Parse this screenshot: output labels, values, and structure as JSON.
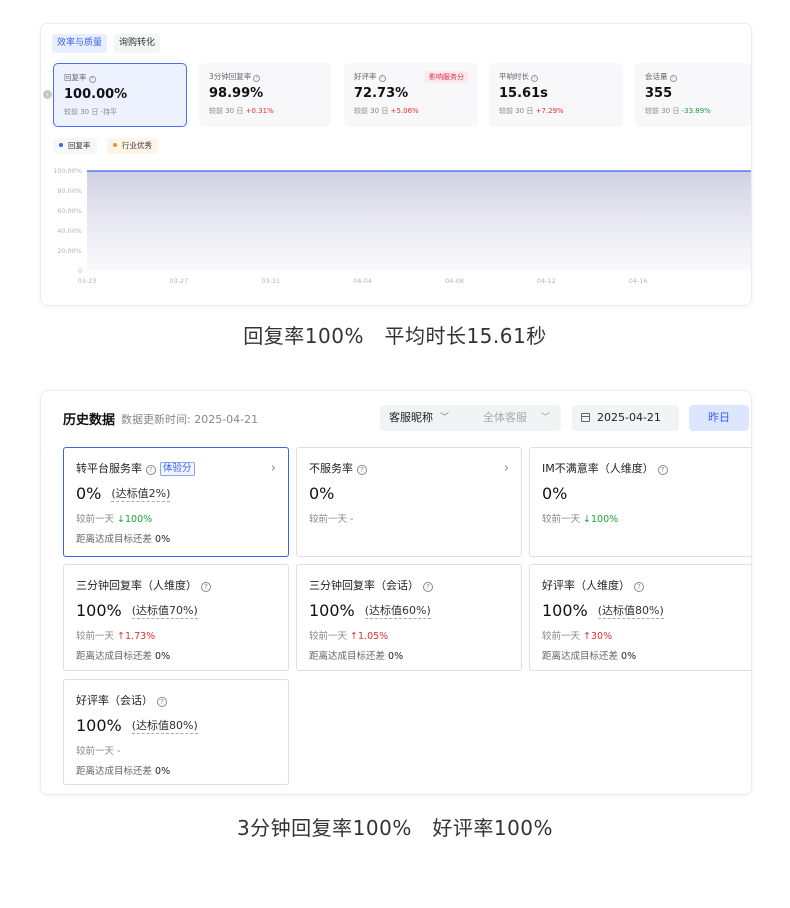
{
  "panel1": {
    "tabs": [
      {
        "label": "效率与质量",
        "active": true
      },
      {
        "label": "询购转化",
        "active": false
      }
    ],
    "metrics": [
      {
        "label": "回复率",
        "value": "100.00%",
        "cmp_prefix": "较前 30 日",
        "cmp_value": "-持平",
        "trend": "flat",
        "selected": true
      },
      {
        "label": "3分钟回复率",
        "value": "98.99%",
        "cmp_prefix": "较前 30 日",
        "cmp_value": "+0.31%",
        "trend": "up"
      },
      {
        "label": "好评率",
        "value": "72.73%",
        "cmp_prefix": "较前 30 日",
        "cmp_value": "+5.06%",
        "trend": "up",
        "badge": "影响服务分"
      },
      {
        "label": "平响时长",
        "value": "15.61s",
        "cmp_prefix": "较前 30 日",
        "cmp_value": "+7.29%",
        "trend": "up"
      },
      {
        "label": "会话量",
        "value": "355",
        "cmp_prefix": "较前 30 日",
        "cmp_value": "-33.89%",
        "trend": "down"
      }
    ],
    "legend": [
      {
        "label": "回复率",
        "color": "#3a63f0"
      },
      {
        "label": "行业优秀",
        "color": "#f5902a"
      }
    ]
  },
  "chart_data": {
    "type": "area",
    "x": [
      "03-23",
      "03-24",
      "03-25",
      "03-26",
      "03-27",
      "03-28",
      "03-29",
      "03-30",
      "03-31",
      "04-01",
      "04-02",
      "04-03",
      "04-04",
      "04-05",
      "04-06",
      "04-07",
      "04-08",
      "04-09",
      "04-10",
      "04-11",
      "04-12",
      "04-13",
      "04-14",
      "04-15",
      "04-16",
      "04-17",
      "04-18",
      "04-19",
      "04-20",
      "04-21"
    ],
    "xticks": [
      "03-23",
      "03-27",
      "03-31",
      "04-04",
      "04-08",
      "04-12",
      "04-16"
    ],
    "yticks": [
      "100.00%",
      "80.00%",
      "60.00%",
      "40.00%",
      "20.00%",
      "0"
    ],
    "ylim": [
      0,
      100
    ],
    "series": [
      {
        "name": "回复率",
        "values": [
          100,
          100,
          100,
          100,
          100,
          100,
          100,
          100,
          100,
          100,
          100,
          100,
          100,
          100,
          100,
          100,
          100,
          100,
          100,
          100,
          100,
          100,
          100,
          100,
          100,
          100,
          100,
          100,
          100,
          100
        ]
      }
    ],
    "grid": false,
    "legend": "top-left"
  },
  "caption1": "回复率100%　平均时长15.61秒",
  "panel2": {
    "title": "历史数据",
    "update_label": "数据更新时间: 2025-04-21",
    "agent_select": "客服昵称",
    "agent_placeholder": "全体客服",
    "date": "2025-04-21",
    "yesterday_button": "昨日",
    "cards": [
      {
        "title": "转平台服务率",
        "badge": "体验分",
        "value": "0%",
        "standard": "(达标值2%)",
        "cmp_label": "较前一天",
        "cmp": "↓100%",
        "trend": "down",
        "gap_label": "距离达成目标还差",
        "gap": "0%",
        "arrow": true
      },
      {
        "title": "不服务率",
        "value": "0%",
        "cmp_label": "较前一天",
        "cmp": "-",
        "trend": "flat",
        "arrow": true
      },
      {
        "title": "IM不满意率（人维度）",
        "value": "0%",
        "cmp_label": "较前一天",
        "cmp": "↓100%",
        "trend": "down"
      },
      {
        "title": "三分钟回复率（人维度）",
        "value": "100%",
        "standard": "(达标值70%)",
        "cmp_label": "较前一天",
        "cmp": "↑1.73%",
        "trend": "up",
        "gap_label": "距离达成目标还差",
        "gap": "0%"
      },
      {
        "title": "三分钟回复率（会话）",
        "value": "100%",
        "standard": "(达标值60%)",
        "cmp_label": "较前一天",
        "cmp": "↑1.05%",
        "trend": "up",
        "gap_label": "距离达成目标还差",
        "gap": "0%"
      },
      {
        "title": "好评率（人维度）",
        "value": "100%",
        "standard": "(达标值80%)",
        "cmp_label": "较前一天",
        "cmp": "↑30%",
        "trend": "up",
        "gap_label": "距离达成目标还差",
        "gap": "0%"
      },
      {
        "title": "好评率（会话）",
        "value": "100%",
        "standard": "(达标值80%)",
        "cmp_label": "较前一天",
        "cmp": "-",
        "trend": "flat",
        "gap_label": "距离达成目标还差",
        "gap": "0%"
      }
    ]
  },
  "caption2": "3分钟回复率100%　好评率100%"
}
